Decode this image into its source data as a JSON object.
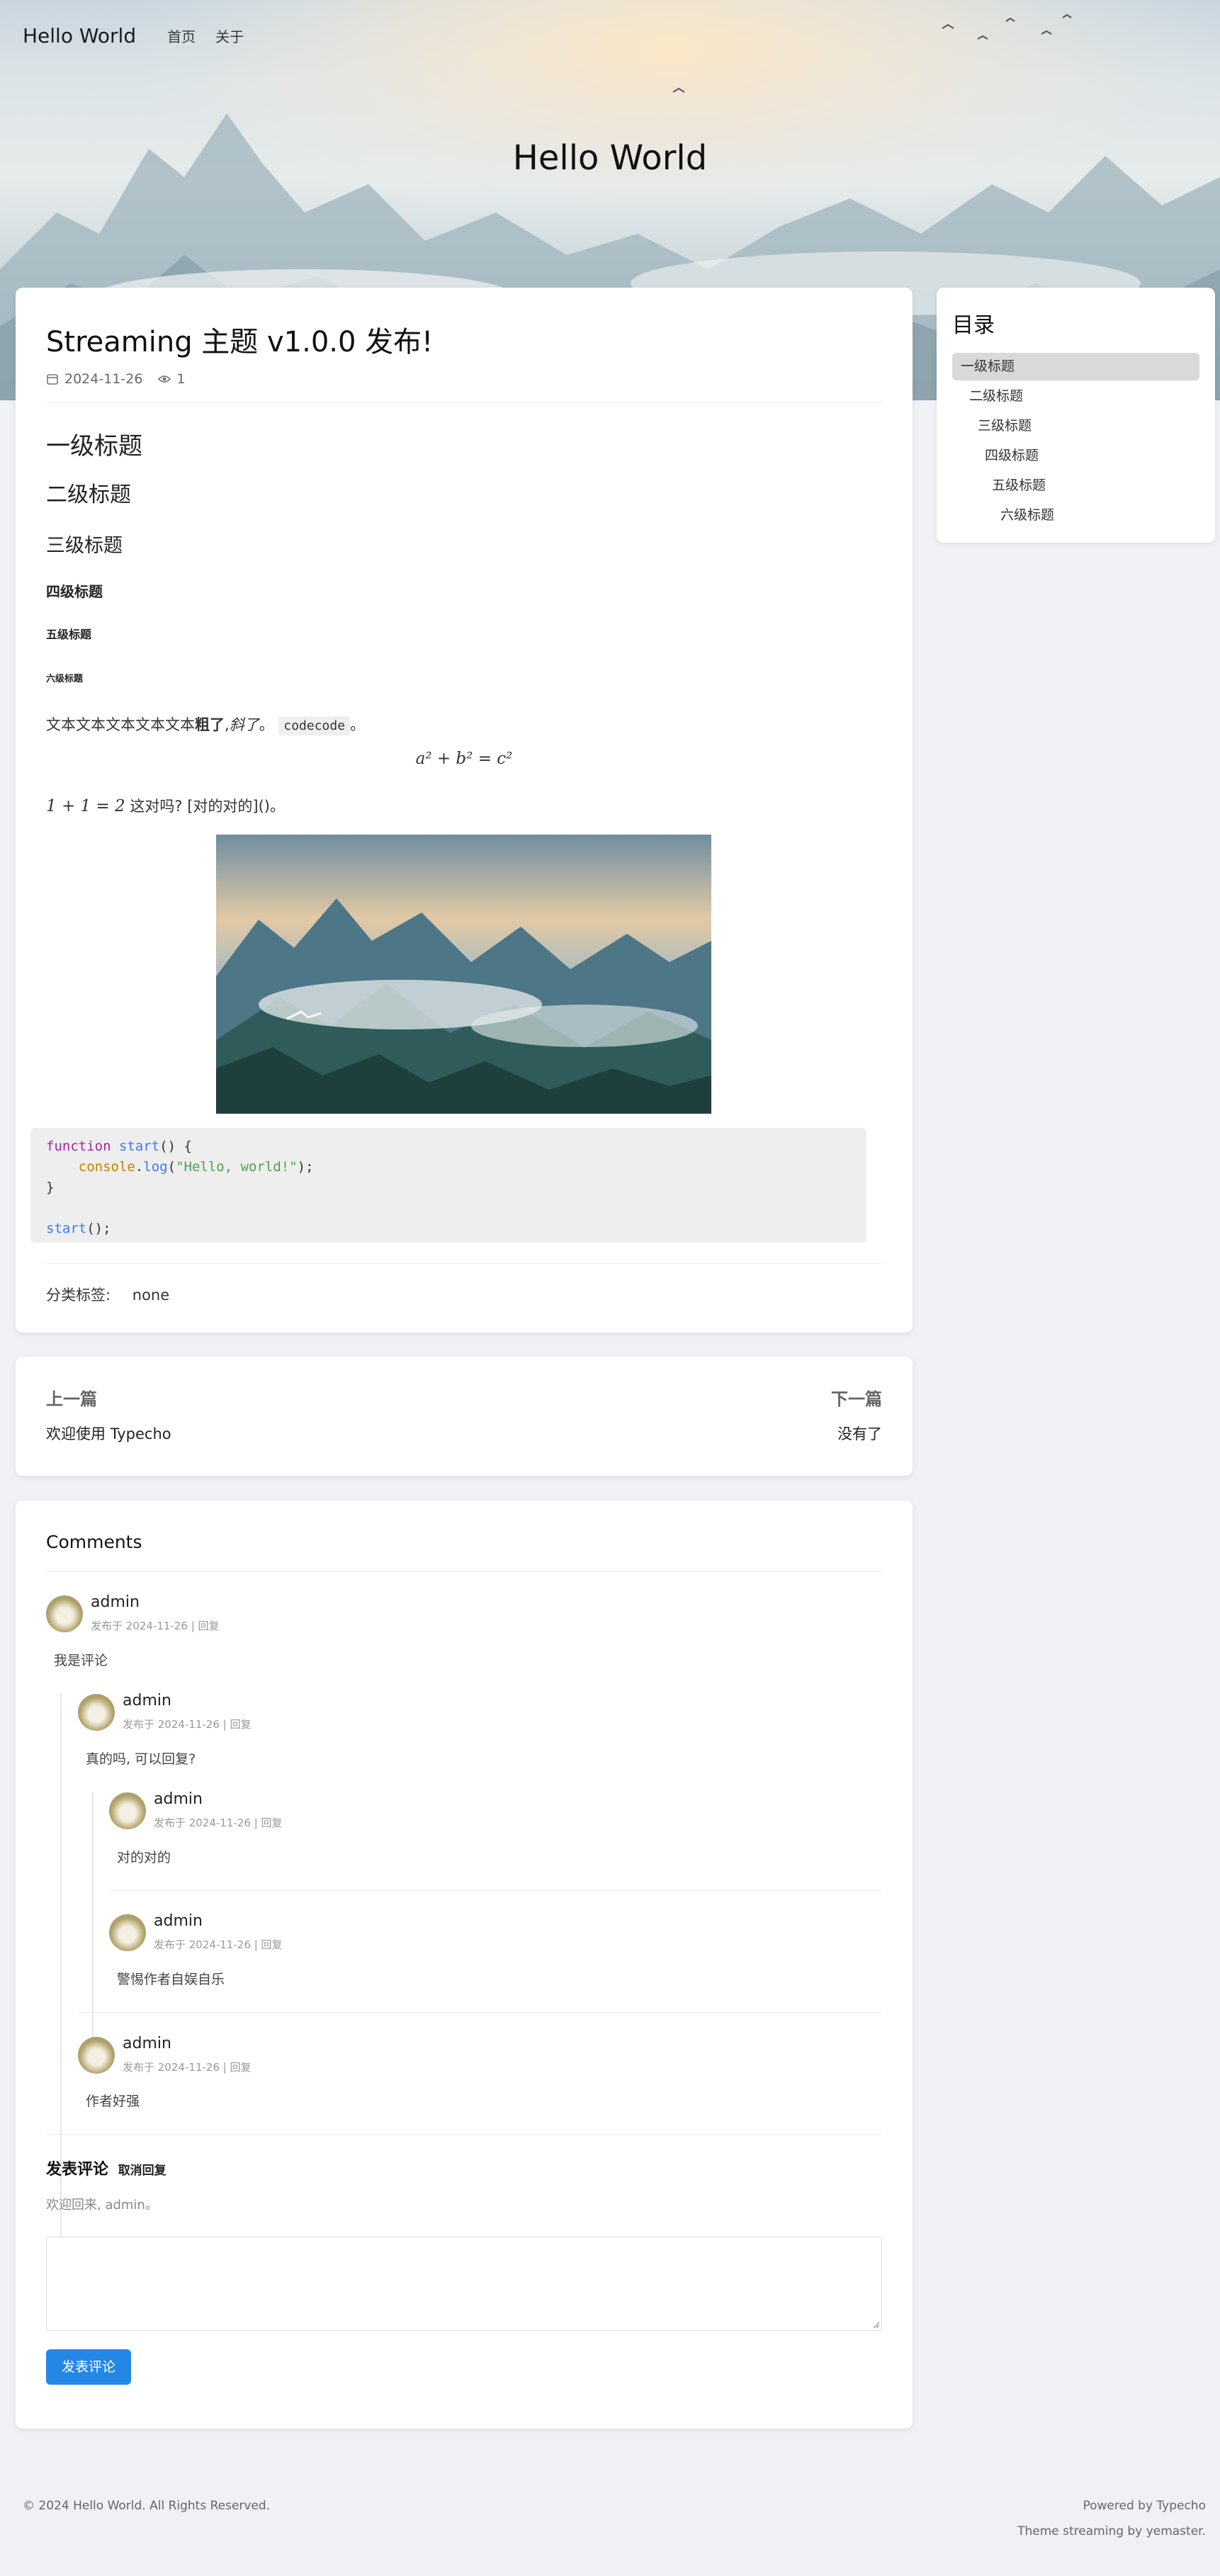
{
  "site": {
    "brand": "Hello World",
    "nav": [
      "首页",
      "关于"
    ],
    "hero_title": "Hello World"
  },
  "post": {
    "title": "Streaming 主题 v1.0.0 发布!",
    "date": "2024-11-26",
    "views": "1",
    "headings": [
      "一级标题",
      "二级标题",
      "三级标题",
      "四级标题",
      "五级标题",
      "六级标题"
    ],
    "paragraph": {
      "plain": "文本文本文本文本文本",
      "bold": "粗了",
      "comma": ",",
      "italic": "斜了",
      "period": "。",
      "code": "codecode",
      "end": "。"
    },
    "formula": "a² + b² = c²",
    "inline_math": "1 + 1 = 2",
    "inline_after": "这对吗? [对的对的]()。",
    "code_lines": {
      "l1_kw": "function",
      "l1_fn": "start",
      "l1_rest": "() {",
      "l2_obj": "console",
      "l2_dot": ".",
      "l2_fn": "log",
      "l2_open": "(",
      "l2_str": "\"Hello, world!\"",
      "l2_close": ");",
      "l3": "}",
      "l5_fn": "start",
      "l5_rest": "();"
    },
    "tags_label": "分类标签:",
    "tags_value": "none"
  },
  "toc": {
    "title": "目录",
    "items": [
      "一级标题",
      "二级标题",
      "三级标题",
      "四级标题",
      "五级标题",
      "六级标题"
    ]
  },
  "post_nav": {
    "prev_label": "上一篇",
    "prev_title": "欢迎使用 Typecho",
    "next_label": "下一篇",
    "next_title": "没有了"
  },
  "comments": {
    "heading": "Comments",
    "items": [
      {
        "author": "admin",
        "meta": "发布于 2024-11-26 | 回复",
        "text": "我是评论"
      },
      {
        "author": "admin",
        "meta": "发布于 2024-11-26 | 回复",
        "text": "真的吗, 可以回复?"
      },
      {
        "author": "admin",
        "meta": "发布于 2024-11-26 | 回复",
        "text": "对的对的"
      },
      {
        "author": "admin",
        "meta": "发布于 2024-11-26 | 回复",
        "text": "警惕作者自娱自乐"
      },
      {
        "author": "admin",
        "meta": "发布于 2024-11-26 | 回复",
        "text": "作者好强"
      }
    ],
    "form_title": "发表评论",
    "cancel_reply": "取消回复",
    "welcome": "欢迎回来, admin。",
    "submit": "发表评论"
  },
  "footer": {
    "copyright": "© 2024 Hello World. All Rights Reserved.",
    "powered": "Powered by Typecho",
    "theme": "Theme streaming by yemaster."
  },
  "colors": {
    "accent": "#2487e6",
    "page_bg": "#eff1f5",
    "toc_active": "#d9d9d9"
  }
}
